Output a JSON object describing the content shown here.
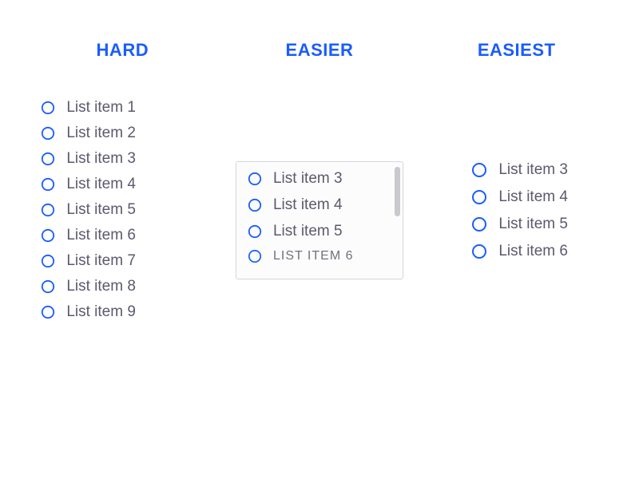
{
  "colors": {
    "accent": "#1a5cff",
    "text": "#5a5a6e",
    "border": "#d8d8dc"
  },
  "columns": {
    "hard": {
      "title": "HARD",
      "items": [
        {
          "label": "List item 1"
        },
        {
          "label": "List item 2"
        },
        {
          "label": "List item 3"
        },
        {
          "label": "List item 4"
        },
        {
          "label": "List item 5"
        },
        {
          "label": "List item 6"
        },
        {
          "label": "List item 7"
        },
        {
          "label": "List item 8"
        },
        {
          "label": "List item 9"
        }
      ]
    },
    "easier": {
      "title": "EASIER",
      "items": [
        {
          "label": "List item 3"
        },
        {
          "label": "List item 4"
        },
        {
          "label": "List item 5"
        },
        {
          "label": "List item 6"
        }
      ]
    },
    "easiest": {
      "title": "EASIEST",
      "items": [
        {
          "label": "List item 3"
        },
        {
          "label": "List item 4"
        },
        {
          "label": "List item 5"
        },
        {
          "label": "List item 6"
        }
      ]
    }
  }
}
